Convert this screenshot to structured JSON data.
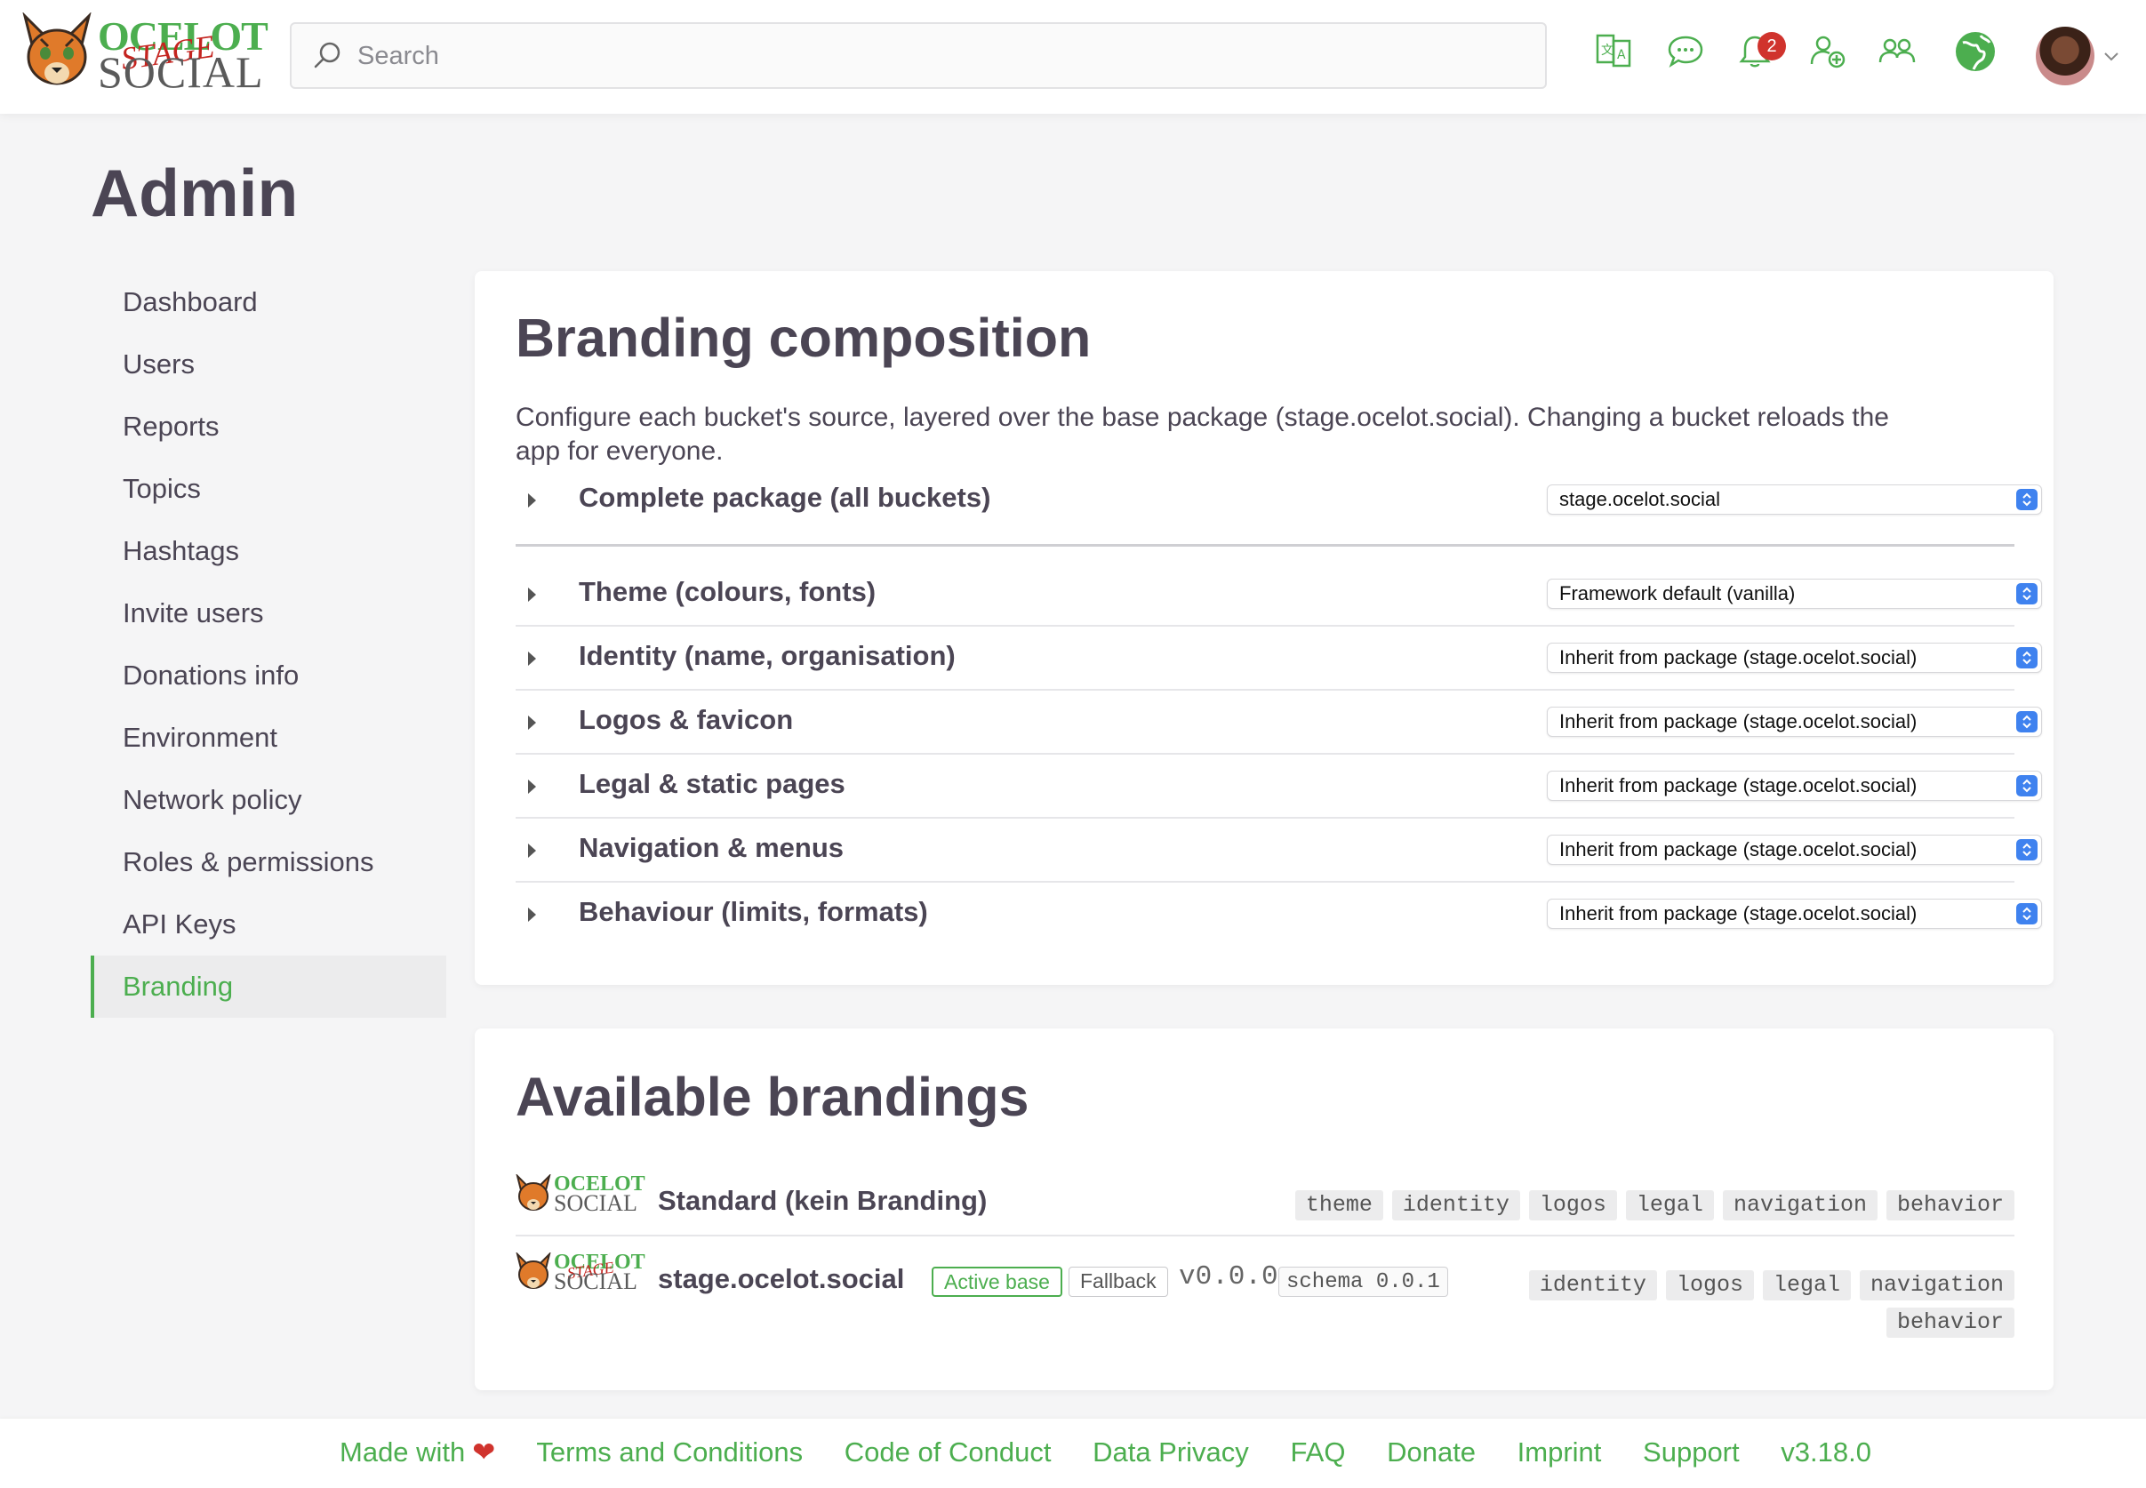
{
  "header": {
    "logo": {
      "line1": "OCELOT",
      "stage": "STAGE",
      "line2": "SOCIAL"
    },
    "search_placeholder": "Search",
    "notification_count": "2",
    "icons": [
      "language-icon",
      "chat-icon",
      "bell-icon",
      "add-user-icon",
      "groups-icon",
      "globe-icon"
    ]
  },
  "page": {
    "title": "Admin"
  },
  "sidebar": {
    "items": [
      {
        "label": "Dashboard"
      },
      {
        "label": "Users"
      },
      {
        "label": "Reports"
      },
      {
        "label": "Topics"
      },
      {
        "label": "Hashtags"
      },
      {
        "label": "Invite users"
      },
      {
        "label": "Donations info"
      },
      {
        "label": "Environment"
      },
      {
        "label": "Network policy"
      },
      {
        "label": "Roles & permissions"
      },
      {
        "label": "API Keys"
      },
      {
        "label": "Branding"
      }
    ],
    "active": "Branding"
  },
  "composition": {
    "title": "Branding composition",
    "description": "Configure each bucket's source, layered over the base package (stage.ocelot.social). Changing a bucket reloads the app for everyone.",
    "package_row": {
      "label": "Complete package (all buckets)",
      "value": "stage.ocelot.social"
    },
    "buckets": [
      {
        "label": "Theme (colours, fonts)",
        "value": "Framework default (vanilla)"
      },
      {
        "label": "Identity (name, organisation)",
        "value": "Inherit from package (stage.ocelot.social)"
      },
      {
        "label": "Logos & favicon",
        "value": "Inherit from package (stage.ocelot.social)"
      },
      {
        "label": "Legal & static pages",
        "value": "Inherit from package (stage.ocelot.social)"
      },
      {
        "label": "Navigation & menus",
        "value": "Inherit from package (stage.ocelot.social)"
      },
      {
        "label": "Behaviour (limits, formats)",
        "value": "Inherit from package (stage.ocelot.social)"
      }
    ]
  },
  "available": {
    "title": "Available brandings",
    "items": [
      {
        "logo": {
          "line1": "OCELOT",
          "line2": "SOCIAL"
        },
        "name": "Standard (kein Branding)",
        "tags": [
          "theme",
          "identity",
          "logos",
          "legal",
          "navigation",
          "behavior"
        ]
      },
      {
        "logo": {
          "line1": "OCELOT",
          "stage": "STAGE",
          "line2": "SOCIAL"
        },
        "name": "stage.ocelot.social",
        "active_badge": "Active base",
        "fallback_badge": "Fallback",
        "version": "v0.0.0",
        "schema": "schema 0.0.1",
        "tags": [
          "identity",
          "logos",
          "legal",
          "navigation",
          "behavior"
        ]
      }
    ]
  },
  "footer": {
    "made_with": "Made with",
    "links": [
      "Terms and Conditions",
      "Code of Conduct",
      "Data Privacy",
      "FAQ",
      "Donate",
      "Imprint",
      "Support",
      "v3.18.0"
    ]
  },
  "colors": {
    "accent": "#4cae4f",
    "text": "#4b4554",
    "badge": "#d0332d",
    "select_stepper": "#3f82ef"
  }
}
